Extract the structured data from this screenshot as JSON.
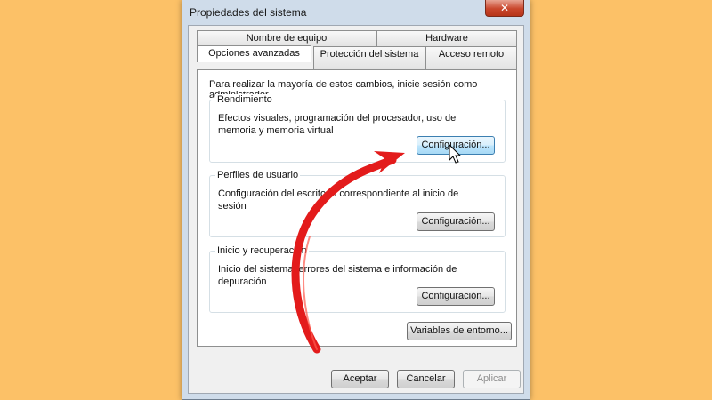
{
  "window": {
    "title": "Propiedades del sistema",
    "close_symbol": "✕"
  },
  "tabs": {
    "row1": [
      "Nombre de equipo",
      "Hardware"
    ],
    "row2": [
      "Opciones avanzadas",
      "Protección del sistema",
      "Acceso remoto"
    ],
    "active": "Opciones avanzadas"
  },
  "panel": {
    "admin_note": "Para realizar la mayoría de estos cambios, inicie sesión como administrador.",
    "rendimiento": {
      "title": "Rendimiento",
      "description": "Efectos visuales, programación del procesador, uso de memoria y memoria virtual",
      "button": "Configuración..."
    },
    "perfiles": {
      "title": "Perfiles de usuario",
      "description": "Configuración del escritorio correspondiente al inicio de sesión",
      "button": "Configuración..."
    },
    "inicio": {
      "title": "Inicio y recuperación",
      "description": "Inicio del sistema, errores del sistema e información de depuración",
      "button": "Configuración..."
    },
    "env_button": "Variables de entorno..."
  },
  "footer": {
    "ok": "Aceptar",
    "cancel": "Cancelar",
    "apply": "Aplicar"
  },
  "annotation": {
    "arrow_color": "#e31b1b",
    "icons": [
      "red-arrow-icon",
      "mouse-cursor-icon"
    ]
  }
}
